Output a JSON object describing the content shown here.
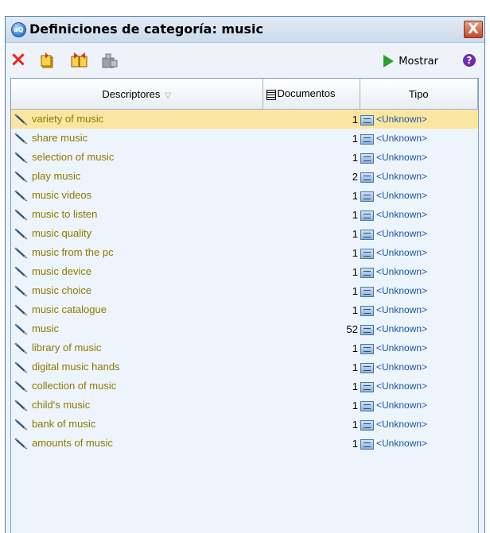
{
  "window": {
    "title": "Definiciones de categoría: music",
    "close_label": "X"
  },
  "toolbar": {
    "show_label": "Mostrar",
    "help_label": "?"
  },
  "table": {
    "headers": {
      "descriptors": "Descriptores",
      "documents": "Documentos",
      "type": "Tipo"
    },
    "rows": [
      {
        "desc": "variety of music",
        "count": "1",
        "type": "<Unknown>",
        "selected": true
      },
      {
        "desc": "share music",
        "count": "1",
        "type": "<Unknown>"
      },
      {
        "desc": "selection of music",
        "count": "1",
        "type": "<Unknown>"
      },
      {
        "desc": "play music",
        "count": "2",
        "type": "<Unknown>"
      },
      {
        "desc": "music videos",
        "count": "1",
        "type": "<Unknown>"
      },
      {
        "desc": "music to listen",
        "count": "1",
        "type": "<Unknown>"
      },
      {
        "desc": "music quality",
        "count": "1",
        "type": "<Unknown>"
      },
      {
        "desc": "music from the pc",
        "count": "1",
        "type": "<Unknown>"
      },
      {
        "desc": "music device",
        "count": "1",
        "type": "<Unknown>"
      },
      {
        "desc": "music choice",
        "count": "1",
        "type": "<Unknown>"
      },
      {
        "desc": "music catalogue",
        "count": "1",
        "type": "<Unknown>"
      },
      {
        "desc": "music",
        "count": "52",
        "type": "<Unknown>"
      },
      {
        "desc": "library of music",
        "count": "1",
        "type": "<Unknown>"
      },
      {
        "desc": "digital music hands",
        "count": "1",
        "type": "<Unknown>"
      },
      {
        "desc": "collection of music",
        "count": "1",
        "type": "<Unknown>"
      },
      {
        "desc": "child's music",
        "count": "1",
        "type": "<Unknown>"
      },
      {
        "desc": "bank of music",
        "count": "1",
        "type": "<Unknown>"
      },
      {
        "desc": "amounts of music",
        "count": "1",
        "type": "<Unknown>"
      }
    ]
  }
}
